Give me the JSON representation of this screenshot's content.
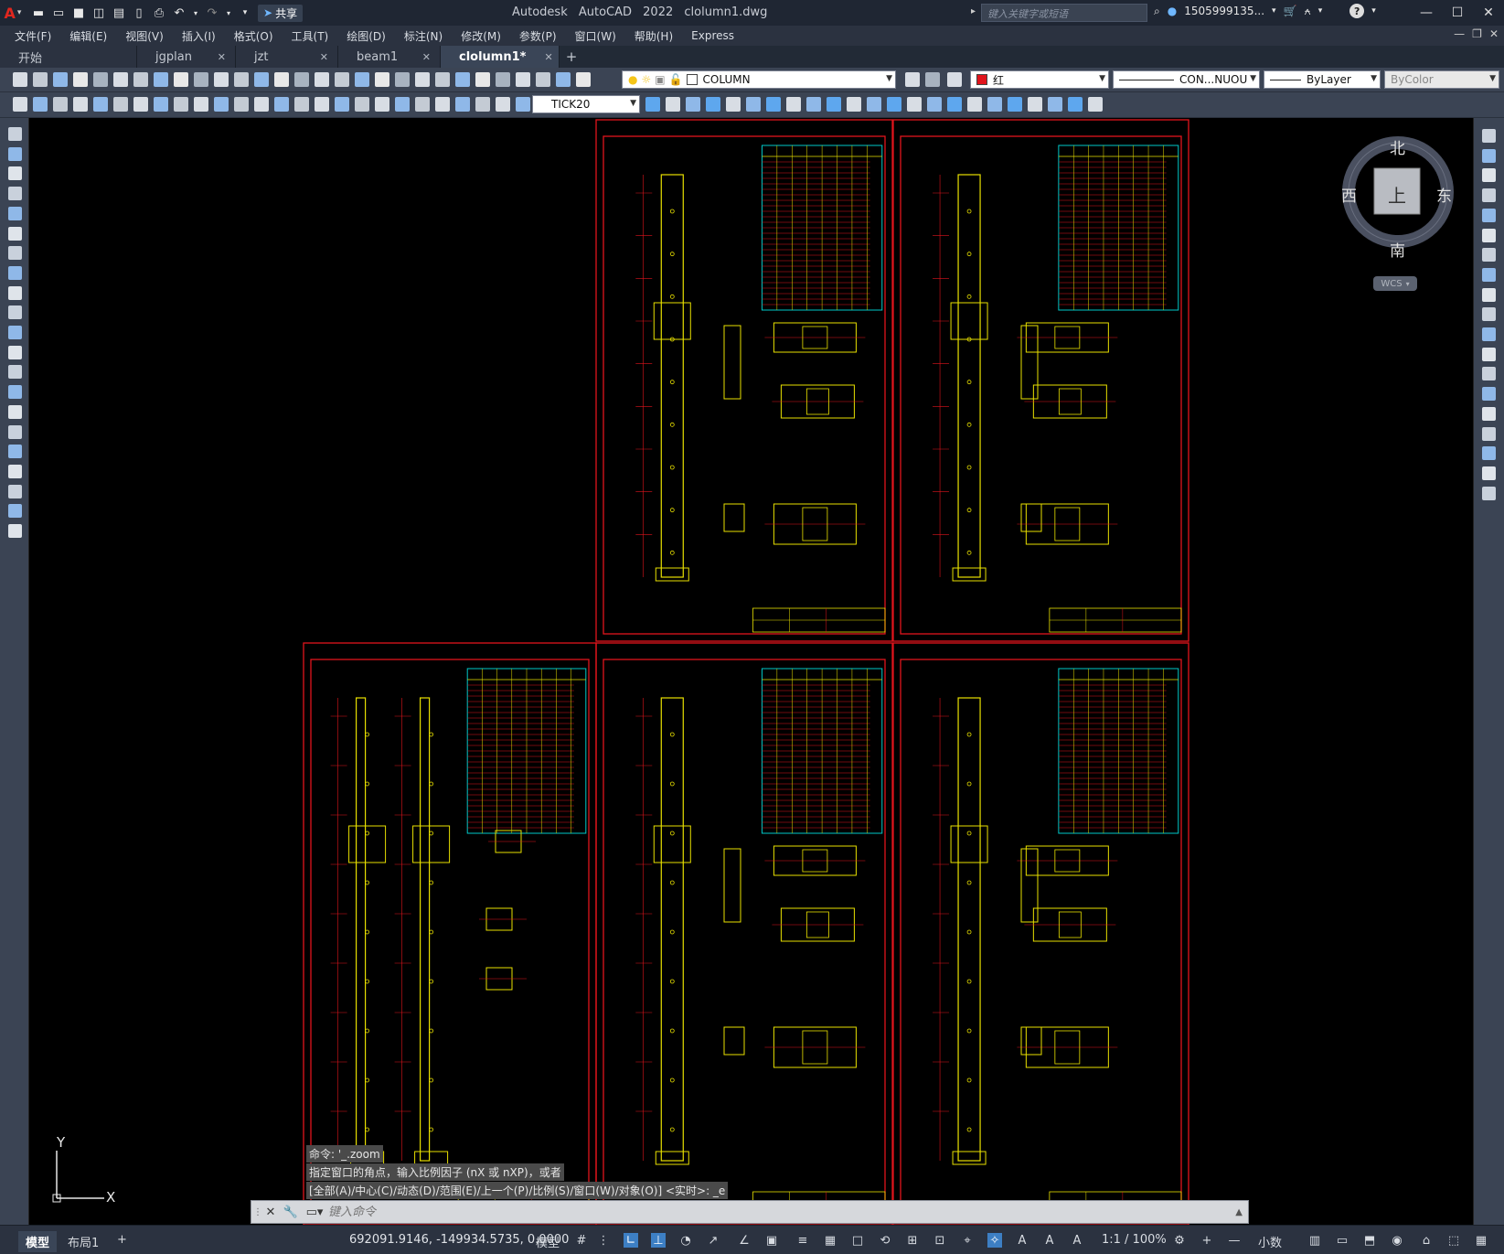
{
  "titlebar": {
    "logo": "A",
    "share": "共享",
    "app_title": "Autodesk AutoCAD 2022",
    "file_title": "clolumn1.dwg",
    "search_placeholder": "键入关键字或短语",
    "user": "1505999135...",
    "help": "?"
  },
  "menu": [
    "文件(F)",
    "编辑(E)",
    "视图(V)",
    "插入(I)",
    "格式(O)",
    "工具(T)",
    "绘图(D)",
    "标注(N)",
    "修改(M)",
    "参数(P)",
    "窗口(W)",
    "帮助(H)",
    "Express"
  ],
  "tabs": [
    {
      "label": "开始",
      "closable": false,
      "active": false
    },
    {
      "label": "jgplan",
      "closable": true,
      "active": false
    },
    {
      "label": "jzt",
      "closable": true,
      "active": false
    },
    {
      "label": "beam1",
      "closable": true,
      "active": false
    },
    {
      "label": "clolumn1*",
      "closable": true,
      "active": true
    }
  ],
  "toolbar": {
    "layer_value": "COLUMN",
    "color_value": "红",
    "linetype_value": "CON...NUOU",
    "lineweight_value": "ByLayer",
    "plotstyle_value": "ByColor",
    "dimstyle_value": "TICK20"
  },
  "viewcube": {
    "north": "北",
    "south": "南",
    "east": "东",
    "west": "西",
    "top": "上",
    "wcs": "WCS"
  },
  "ucs": {
    "x": "X",
    "y": "Y"
  },
  "command": {
    "history": [
      "命令: '_.zoom",
      "指定窗口的角点，输入比例因子 (nX 或 nXP)，或者",
      "[全部(A)/中心(C)/动态(D)/范围(E)/上一个(P)/比例(S)/窗口(W)/对象(O)] <实时>: _e"
    ],
    "placeholder": "键入命令"
  },
  "status": {
    "model_tab": "模型",
    "layout_tab": "布局1",
    "add": "+",
    "coords": "692091.9146, -149934.5735, 0.0000",
    "space": "模型",
    "scale": "1:1 / 100%",
    "units": "小数"
  },
  "colors": {
    "frame_red": "#e0141c",
    "drawing_yellow": "#e8e000",
    "table_cyan": "#00c8c8",
    "canvas": "#000000"
  }
}
